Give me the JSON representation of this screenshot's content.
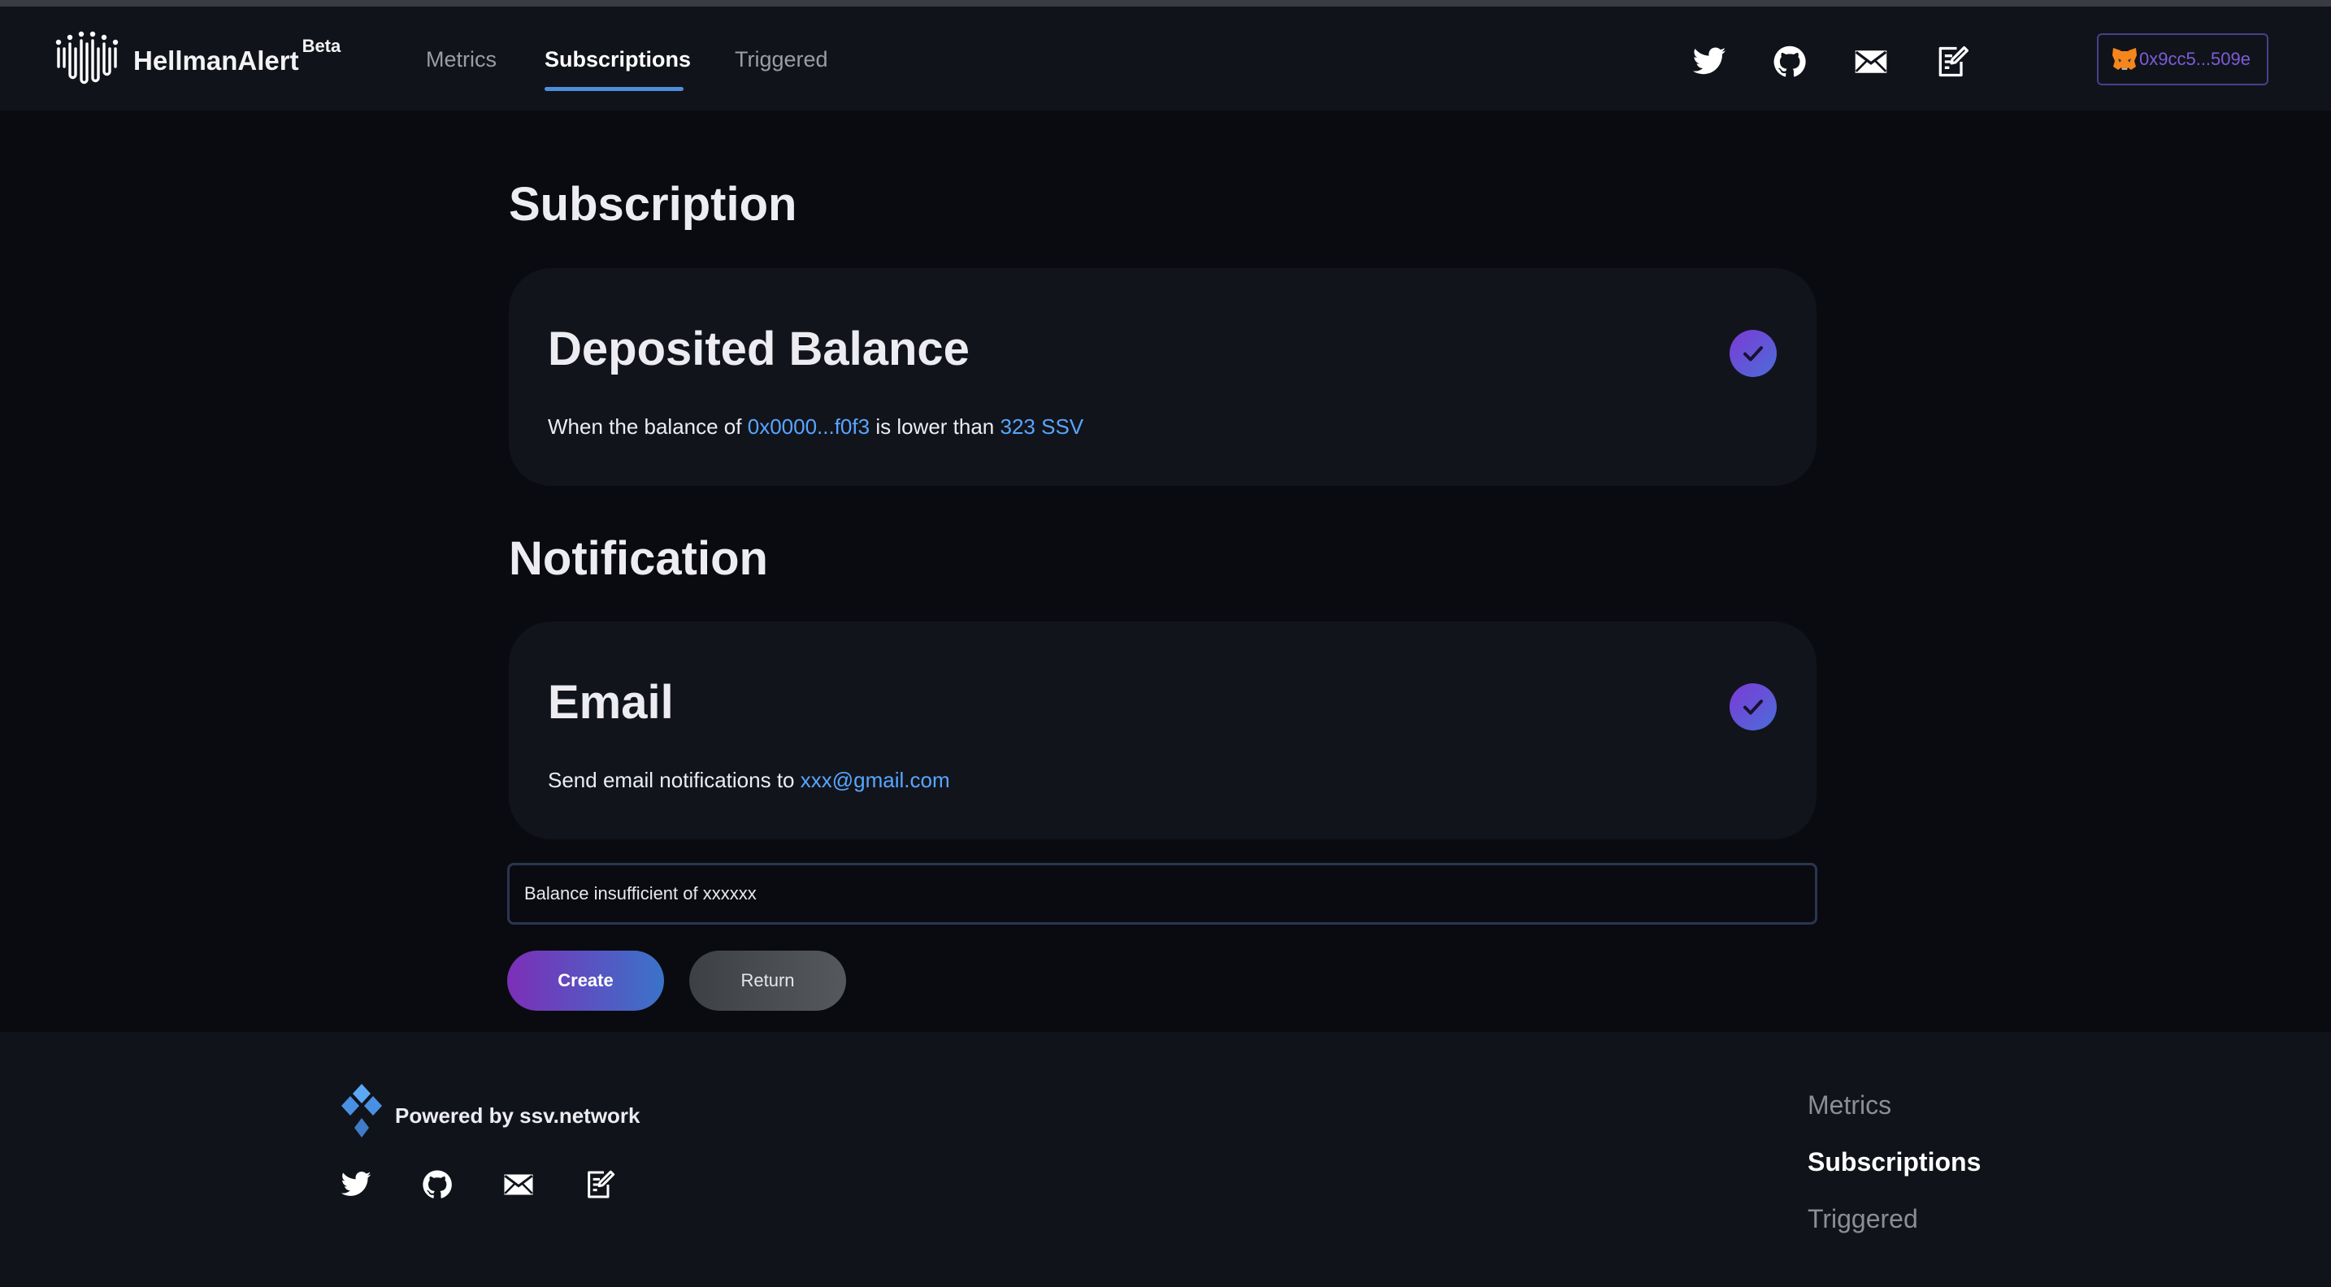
{
  "header": {
    "brand": "HellmanAlert",
    "badge": "Beta",
    "nav": [
      "Metrics",
      "Subscriptions",
      "Triggered"
    ],
    "active_nav": "Subscriptions",
    "icons": [
      "twitter-icon",
      "github-icon",
      "mail-icon",
      "docs-icon"
    ],
    "wallet_address": "0x9cc5...509e"
  },
  "subscription": {
    "section_title": "Subscription",
    "card_title": "Deposited Balance",
    "desc_prefix": "When the balance of",
    "address": "0x0000...f0f3",
    "desc_middle": "is lower than",
    "threshold": "323 SSV"
  },
  "notification": {
    "section_title": "Notification",
    "card_title": "Email",
    "desc_prefix": "Send email notifications to",
    "email": "xxx@gmail.com"
  },
  "message_input": {
    "value": "Balance insufficient of xxxxxx"
  },
  "buttons": {
    "create": "Create",
    "return": "Return"
  },
  "footer": {
    "powered_by": "Powered by ssv.network",
    "nav": [
      "Metrics",
      "Subscriptions",
      "Triggered"
    ],
    "active_nav": "Subscriptions"
  },
  "colors": {
    "background": "#0a0b10",
    "panel": "#11131b",
    "accent_link": "#58a6ff",
    "accent_purple": "#7c3ad6",
    "nav_underline": "#4f8edb"
  }
}
